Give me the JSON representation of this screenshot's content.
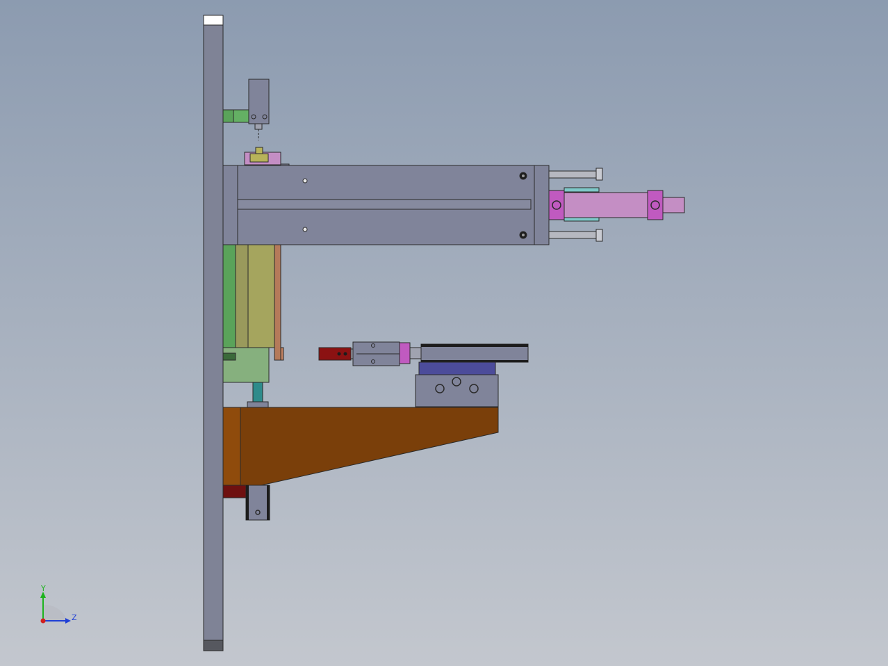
{
  "viewport": {
    "background_top": "#8c9bb0",
    "background_bottom": "#c3c7ce"
  },
  "triad": {
    "y_label": "Y",
    "z_label": "Z",
    "y_color": "#1db31d",
    "z_color": "#1f3fd6",
    "x_color": "#d21f1f"
  },
  "part_colors": {
    "base_plate": "#7f8396",
    "linear_module": "#80849a",
    "bracket": "#7a3f0a",
    "bracket_face": "#8f4b0c",
    "green_block": "#5aa35a",
    "olive_block": "#9a9a5c",
    "cylinder": "#c48ec4",
    "magenta": "#c05ac0",
    "dark_red": "#8b1212",
    "red": "#c00f0f",
    "blue_plate": "#4c4c9a",
    "teal": "#2e8b8b"
  }
}
